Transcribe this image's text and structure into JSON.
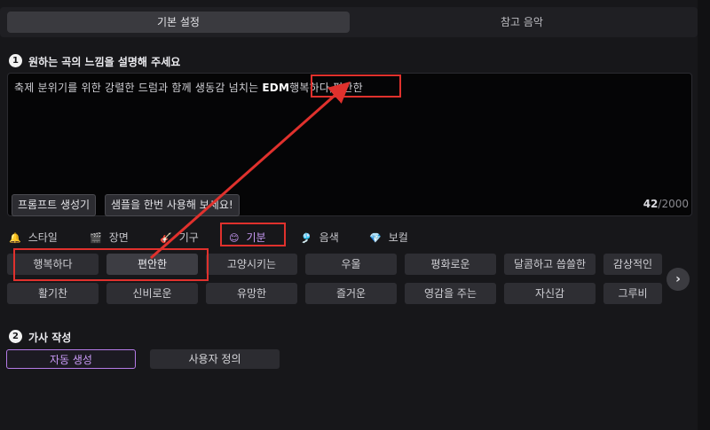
{
  "top_tabs": {
    "basic": "기본 설정",
    "reference": "참고 음악"
  },
  "section1": {
    "number": "1",
    "title": "원하는 곡의 느낌을 설명해 주세요"
  },
  "prompt": {
    "text_main": "축제 분위기를 위한 강렬한 드럼과 함께 생동감 넘치는 ",
    "text_edm": "EDM",
    "text_moods": "행복하다,편안한"
  },
  "prompt_buttons": {
    "generator": "프롬프트 생성기",
    "sample": "샘플을 한번 사용해 보세요!"
  },
  "counter": {
    "current": "42",
    "max": "/2000"
  },
  "categories": [
    {
      "label": "스타일",
      "icon": "bell-icon",
      "glyph": "🔔"
    },
    {
      "label": "장면",
      "icon": "clapper-icon",
      "glyph": "🎬"
    },
    {
      "label": "기구",
      "icon": "guitar-icon",
      "glyph": "🎸"
    },
    {
      "label": "기분",
      "icon": "smile-icon",
      "glyph": "😊"
    },
    {
      "label": "음색",
      "icon": "waves-icon",
      "glyph": "🎐"
    },
    {
      "label": "보컬",
      "icon": "voice-icon",
      "glyph": "💎"
    }
  ],
  "mood_chips_row1": [
    "행복하다",
    "편안한",
    "고양시키는",
    "우울",
    "평화로운",
    "달콤하고 씁쓸한",
    "감상적인"
  ],
  "mood_chips_row2": [
    "활기찬",
    "신비로운",
    "유망한",
    "즐거운",
    "영감을 주는",
    "자신감",
    "그루비"
  ],
  "next_glyph": "›",
  "section2": {
    "number": "2",
    "title": "가사 작성"
  },
  "lyrics_buttons": {
    "auto": "자동 생성",
    "custom": "사용자 정의"
  },
  "colors": {
    "accent": "#b57be8",
    "annotation_red": "#e0312d",
    "background": "#17171a"
  }
}
